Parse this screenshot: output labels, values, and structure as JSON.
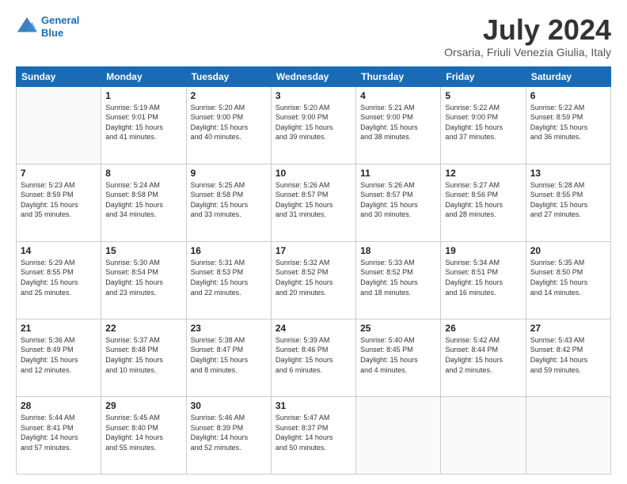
{
  "logo": {
    "line1": "General",
    "line2": "Blue"
  },
  "header": {
    "month": "July 2024",
    "location": "Orsaria, Friuli Venezia Giulia, Italy"
  },
  "weekdays": [
    "Sunday",
    "Monday",
    "Tuesday",
    "Wednesday",
    "Thursday",
    "Friday",
    "Saturday"
  ],
  "weeks": [
    [
      {
        "day": "",
        "info": ""
      },
      {
        "day": "1",
        "info": "Sunrise: 5:19 AM\nSunset: 9:01 PM\nDaylight: 15 hours\nand 41 minutes."
      },
      {
        "day": "2",
        "info": "Sunrise: 5:20 AM\nSunset: 9:00 PM\nDaylight: 15 hours\nand 40 minutes."
      },
      {
        "day": "3",
        "info": "Sunrise: 5:20 AM\nSunset: 9:00 PM\nDaylight: 15 hours\nand 39 minutes."
      },
      {
        "day": "4",
        "info": "Sunrise: 5:21 AM\nSunset: 9:00 PM\nDaylight: 15 hours\nand 38 minutes."
      },
      {
        "day": "5",
        "info": "Sunrise: 5:22 AM\nSunset: 9:00 PM\nDaylight: 15 hours\nand 37 minutes."
      },
      {
        "day": "6",
        "info": "Sunrise: 5:22 AM\nSunset: 8:59 PM\nDaylight: 15 hours\nand 36 minutes."
      }
    ],
    [
      {
        "day": "7",
        "info": "Sunrise: 5:23 AM\nSunset: 8:59 PM\nDaylight: 15 hours\nand 35 minutes."
      },
      {
        "day": "8",
        "info": "Sunrise: 5:24 AM\nSunset: 8:58 PM\nDaylight: 15 hours\nand 34 minutes."
      },
      {
        "day": "9",
        "info": "Sunrise: 5:25 AM\nSunset: 8:58 PM\nDaylight: 15 hours\nand 33 minutes."
      },
      {
        "day": "10",
        "info": "Sunrise: 5:26 AM\nSunset: 8:57 PM\nDaylight: 15 hours\nand 31 minutes."
      },
      {
        "day": "11",
        "info": "Sunrise: 5:26 AM\nSunset: 8:57 PM\nDaylight: 15 hours\nand 30 minutes."
      },
      {
        "day": "12",
        "info": "Sunrise: 5:27 AM\nSunset: 8:56 PM\nDaylight: 15 hours\nand 28 minutes."
      },
      {
        "day": "13",
        "info": "Sunrise: 5:28 AM\nSunset: 8:55 PM\nDaylight: 15 hours\nand 27 minutes."
      }
    ],
    [
      {
        "day": "14",
        "info": "Sunrise: 5:29 AM\nSunset: 8:55 PM\nDaylight: 15 hours\nand 25 minutes."
      },
      {
        "day": "15",
        "info": "Sunrise: 5:30 AM\nSunset: 8:54 PM\nDaylight: 15 hours\nand 23 minutes."
      },
      {
        "day": "16",
        "info": "Sunrise: 5:31 AM\nSunset: 8:53 PM\nDaylight: 15 hours\nand 22 minutes."
      },
      {
        "day": "17",
        "info": "Sunrise: 5:32 AM\nSunset: 8:52 PM\nDaylight: 15 hours\nand 20 minutes."
      },
      {
        "day": "18",
        "info": "Sunrise: 5:33 AM\nSunset: 8:52 PM\nDaylight: 15 hours\nand 18 minutes."
      },
      {
        "day": "19",
        "info": "Sunrise: 5:34 AM\nSunset: 8:51 PM\nDaylight: 15 hours\nand 16 minutes."
      },
      {
        "day": "20",
        "info": "Sunrise: 5:35 AM\nSunset: 8:50 PM\nDaylight: 15 hours\nand 14 minutes."
      }
    ],
    [
      {
        "day": "21",
        "info": "Sunrise: 5:36 AM\nSunset: 8:49 PM\nDaylight: 15 hours\nand 12 minutes."
      },
      {
        "day": "22",
        "info": "Sunrise: 5:37 AM\nSunset: 8:48 PM\nDaylight: 15 hours\nand 10 minutes."
      },
      {
        "day": "23",
        "info": "Sunrise: 5:38 AM\nSunset: 8:47 PM\nDaylight: 15 hours\nand 8 minutes."
      },
      {
        "day": "24",
        "info": "Sunrise: 5:39 AM\nSunset: 8:46 PM\nDaylight: 15 hours\nand 6 minutes."
      },
      {
        "day": "25",
        "info": "Sunrise: 5:40 AM\nSunset: 8:45 PM\nDaylight: 15 hours\nand 4 minutes."
      },
      {
        "day": "26",
        "info": "Sunrise: 5:42 AM\nSunset: 8:44 PM\nDaylight: 15 hours\nand 2 minutes."
      },
      {
        "day": "27",
        "info": "Sunrise: 5:43 AM\nSunset: 8:42 PM\nDaylight: 14 hours\nand 59 minutes."
      }
    ],
    [
      {
        "day": "28",
        "info": "Sunrise: 5:44 AM\nSunset: 8:41 PM\nDaylight: 14 hours\nand 57 minutes."
      },
      {
        "day": "29",
        "info": "Sunrise: 5:45 AM\nSunset: 8:40 PM\nDaylight: 14 hours\nand 55 minutes."
      },
      {
        "day": "30",
        "info": "Sunrise: 5:46 AM\nSunset: 8:39 PM\nDaylight: 14 hours\nand 52 minutes."
      },
      {
        "day": "31",
        "info": "Sunrise: 5:47 AM\nSunset: 8:37 PM\nDaylight: 14 hours\nand 50 minutes."
      },
      {
        "day": "",
        "info": ""
      },
      {
        "day": "",
        "info": ""
      },
      {
        "day": "",
        "info": ""
      }
    ]
  ]
}
